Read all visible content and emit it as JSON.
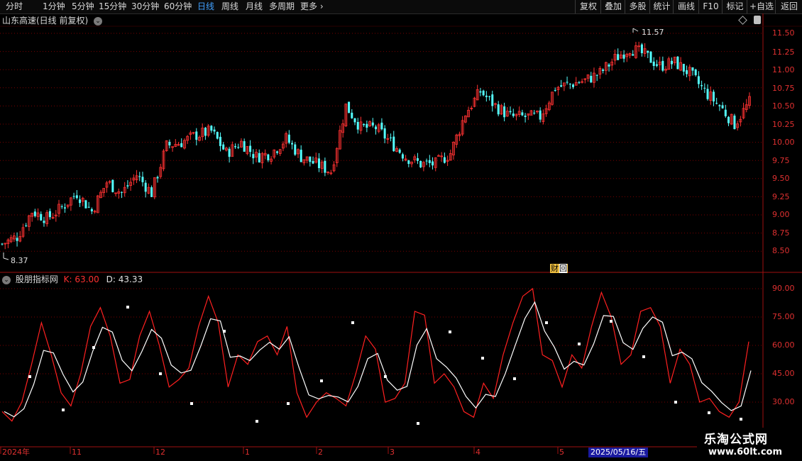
{
  "toolbar": {
    "periods": [
      "分时",
      "1分钟",
      "5分钟",
      "15分钟",
      "30分钟",
      "60分钟",
      "日线",
      "周线",
      "月线",
      "多周期",
      "更多"
    ],
    "active_period": "日线",
    "right_buttons": [
      "复权",
      "叠加",
      "多股",
      "统计",
      "画线",
      "F10",
      "标记",
      "+自选",
      "返回"
    ]
  },
  "main_chart": {
    "title": "山东高速(日线 前复权)",
    "price_axis": [
      "11.50",
      "11.25",
      "11.00",
      "10.75",
      "10.50",
      "10.25",
      "10.00",
      "9.75",
      "9.50",
      "9.25",
      "9.00",
      "8.75",
      "8.50"
    ],
    "high_label": "11.57",
    "low_label": "8.37",
    "finance_tag": "财",
    "finance_tag2": "回"
  },
  "indicator": {
    "name": "股朋指标网",
    "k_label": "K:",
    "k_value": "63.00",
    "d_label": "D:",
    "d_value": "43.33",
    "axis": [
      "90.00",
      "75.00",
      "60.00",
      "45.00",
      "30.00"
    ]
  },
  "x_axis": {
    "labels": [
      "2024年",
      "11",
      "12",
      "1",
      "2",
      "3",
      "4",
      "5"
    ],
    "cursor_date": "2025/05/16/五"
  },
  "watermark": {
    "line1": "乐淘公式网",
    "line2": "www.60lt.com"
  },
  "colors": {
    "up": "#ff3232",
    "down": "#54ffff",
    "k_line": "#ff2020",
    "d_line": "#ffffff",
    "grid": "#7a0000"
  }
}
